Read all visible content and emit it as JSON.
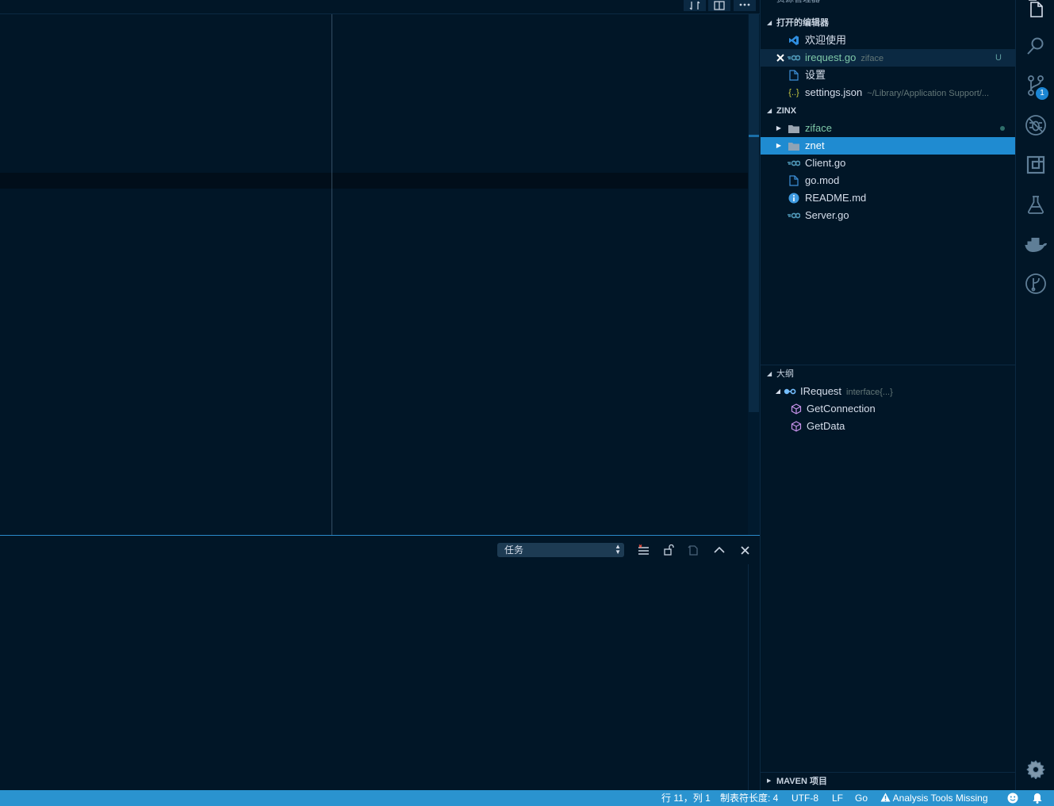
{
  "sidebar": {
    "title": "资源管理器",
    "open_editors": {
      "header": "打开的编辑器",
      "items": [
        {
          "label": "欢迎使用",
          "icon": "vscode-logo-icon"
        },
        {
          "label": "irequest.go",
          "description": "ziface",
          "status": "U",
          "icon": "go-file-icon"
        },
        {
          "label": "设置",
          "icon": "file-icon"
        },
        {
          "label": "settings.json",
          "description": "~/Library/Application Support/...",
          "icon": "json-file-icon"
        }
      ]
    },
    "project": {
      "header": "ZINX",
      "items": [
        {
          "label": "ziface",
          "type": "folder"
        },
        {
          "label": "znet",
          "type": "folder"
        },
        {
          "label": "Client.go",
          "type": "go"
        },
        {
          "label": "go.mod",
          "type": "file"
        },
        {
          "label": "README.md",
          "type": "info"
        },
        {
          "label": "Server.go",
          "type": "go"
        }
      ]
    },
    "outline": {
      "header": "大纲",
      "root": {
        "label": "IRequest",
        "description": "interface{...}"
      },
      "children": [
        {
          "label": "GetConnection"
        },
        {
          "label": "GetData"
        }
      ]
    },
    "maven": {
      "header": "MAVEN 项目"
    }
  },
  "panel": {
    "select_value": "任务"
  },
  "activity_bar": {
    "scm_badge": "1"
  },
  "statusbar": {
    "position": "行 11，列 1",
    "tab_size": "制表符长度: 4",
    "encoding": "UTF-8",
    "eol": "LF",
    "language": "Go",
    "analysis": "Analysis Tools Missing"
  },
  "colors": {
    "background": "#011627",
    "statusbar": "#2a93cf",
    "selection": "#1f8bd1",
    "go_icon": "#519aba",
    "outline_method": "#c792ea"
  }
}
